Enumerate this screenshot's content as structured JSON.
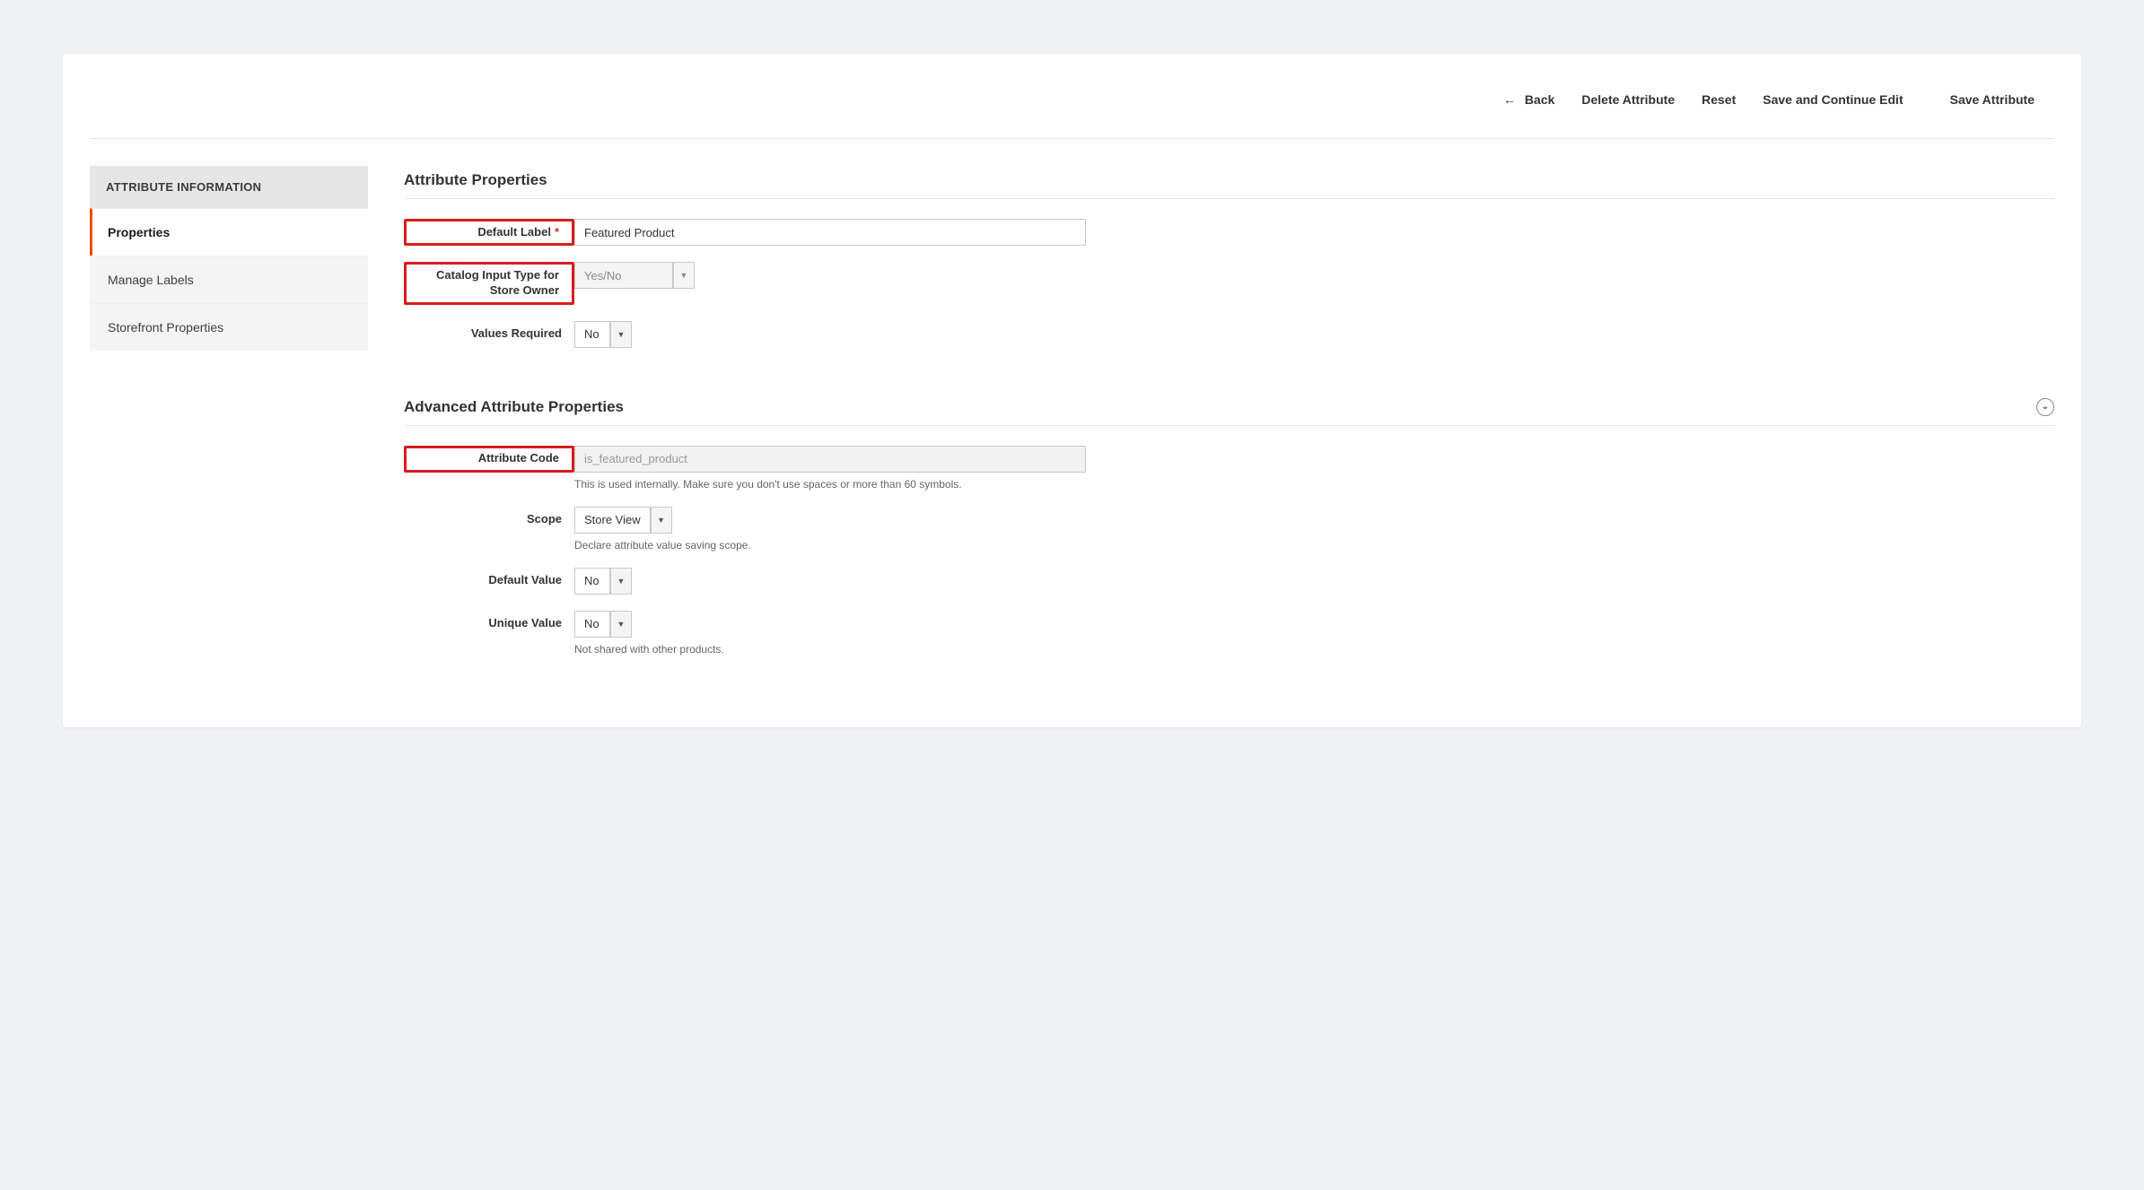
{
  "toolbar": {
    "back": "Back",
    "delete": "Delete Attribute",
    "reset": "Reset",
    "save_continue": "Save and Continue Edit",
    "save": "Save Attribute"
  },
  "sidebar": {
    "header": "ATTRIBUTE INFORMATION",
    "items": [
      {
        "label": "Properties",
        "active": true
      },
      {
        "label": "Manage Labels",
        "active": false
      },
      {
        "label": "Storefront Properties",
        "active": false
      }
    ]
  },
  "sections": {
    "basic": {
      "title": "Attribute Properties",
      "fields": {
        "default_label": {
          "label": "Default Label",
          "value": "Featured Product",
          "required": true,
          "highlight": true
        },
        "input_type": {
          "label": "Catalog Input Type for Store Owner",
          "value": "Yes/No",
          "highlight": true,
          "disabled": true
        },
        "values_required": {
          "label": "Values Required",
          "value": "No"
        }
      }
    },
    "advanced": {
      "title": "Advanced Attribute Properties",
      "fields": {
        "attribute_code": {
          "label": "Attribute Code",
          "value": "is_featured_product",
          "help": "This is used internally. Make sure you don't use spaces or more than 60 symbols.",
          "highlight": true,
          "disabled": true
        },
        "scope": {
          "label": "Scope",
          "value": "Store View",
          "help": "Declare attribute value saving scope."
        },
        "default_value": {
          "label": "Default Value",
          "value": "No"
        },
        "unique_value": {
          "label": "Unique Value",
          "value": "No",
          "help": "Not shared with other products."
        }
      }
    }
  }
}
